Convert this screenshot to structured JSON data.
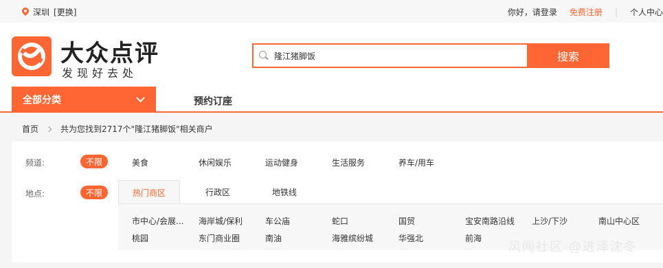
{
  "topbar": {
    "city": "深圳",
    "change": "[更换]",
    "hello": "你好，请登录",
    "register": "免费注册",
    "sep": "|",
    "user_center": "个人中心"
  },
  "header": {
    "brand": "大众点评",
    "slogan": "发现好去处",
    "search_value": "隆江猪脚饭",
    "search_button": "搜索"
  },
  "nav": {
    "all_categories": "全部分类",
    "reserve": "预约订座"
  },
  "breadcrumb": {
    "home": "首页",
    "result": "共为您找到2717个\"隆江猪脚饭\"相关商户"
  },
  "filter": {
    "channel_label": "频道:",
    "location_label": "地点:",
    "unlimited": "不限",
    "channels": [
      "美食",
      "休闲娱乐",
      "运动健身",
      "生活服务",
      "养车/用车"
    ],
    "tabs": [
      "热门商区",
      "行政区",
      "地铁线"
    ],
    "areas_row1": [
      "市中心/会展...",
      "海岸城/保利",
      "车公庙",
      "蛇口",
      "国贸",
      "宝安南路沿线",
      "上沙/下沙",
      "南山中心区"
    ],
    "areas_row2": [
      "桃园",
      "东门商业圈",
      "南油",
      "海雅缤纷城",
      "华强北",
      "前海"
    ]
  },
  "watermark": "风闻社区 @进泽沈冬"
}
